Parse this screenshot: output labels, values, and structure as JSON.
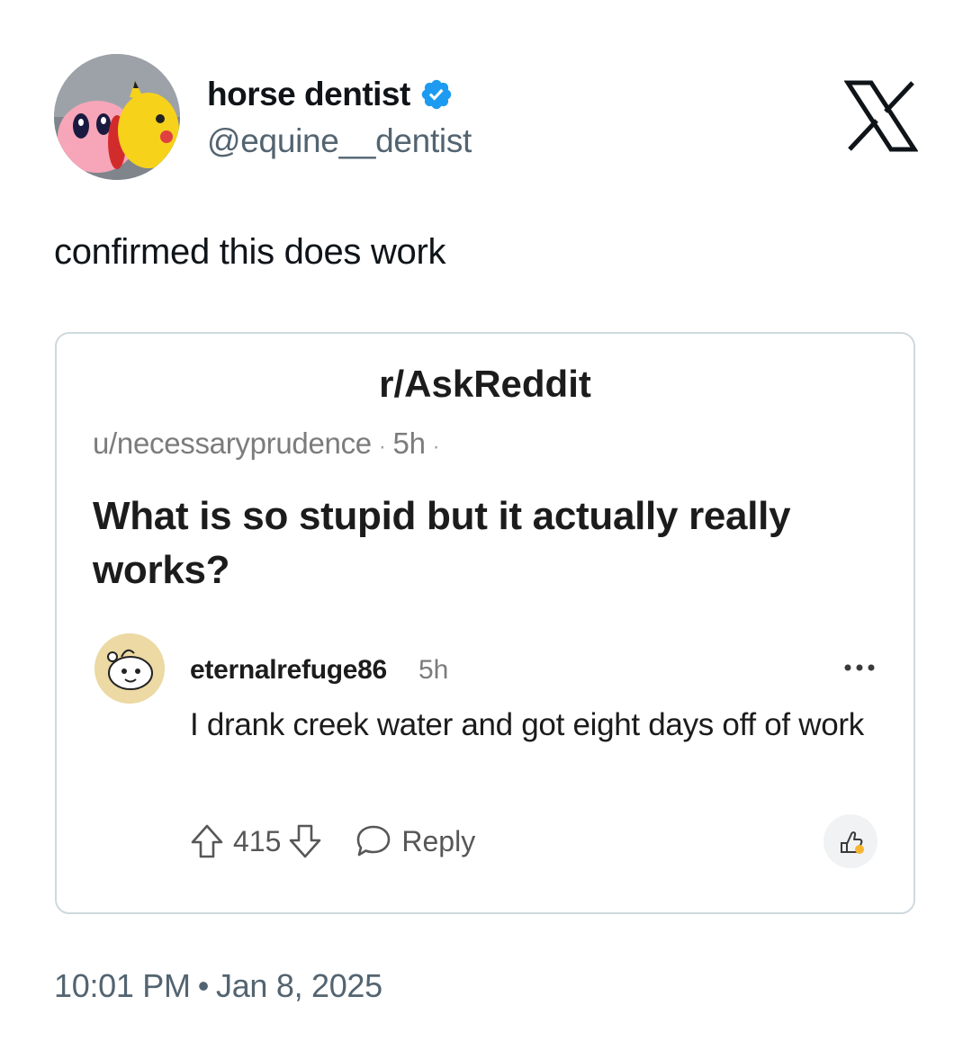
{
  "tweet": {
    "display_name": "horse dentist",
    "handle": "@equine__dentist",
    "text": "confirmed this does work",
    "time": "10:01 PM",
    "separator": "•",
    "date": "Jan 8, 2025",
    "verified": true
  },
  "icons": {
    "verified": "verified-badge-icon",
    "brand": "x-logo-icon",
    "upvote": "upvote-arrow-icon",
    "downvote": "downvote-arrow-icon",
    "reply": "speech-bubble-icon",
    "award": "award-icon",
    "more": "more-dots-icon"
  },
  "embedded_post": {
    "subreddit": "r/AskReddit",
    "author": "u/necessaryprudence",
    "meta_separator": "·",
    "age": "5h",
    "title": "What is so stupid but it actually really works?",
    "comment": {
      "author": "eternalrefuge86",
      "age": "5h",
      "body": "I drank creek water and got eight days off of work",
      "score": "415",
      "reply_label": "Reply"
    }
  },
  "colors": {
    "verified_blue": "#1d9bf0",
    "text_primary": "#0f1419",
    "text_secondary": "#536471",
    "card_border": "#cfd9de",
    "reddit_gray": "#7c7c7c"
  }
}
